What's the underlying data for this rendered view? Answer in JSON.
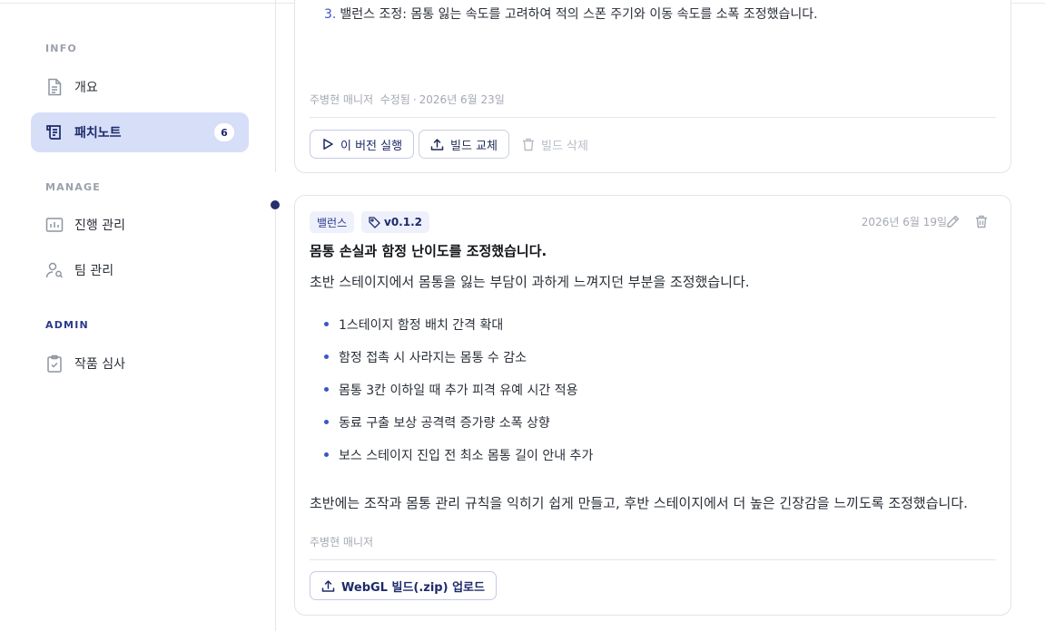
{
  "sidebar": {
    "sections": {
      "info": "INFO",
      "manage": "MANAGE",
      "admin": "ADMIN"
    },
    "items": [
      {
        "label": "개요",
        "icon": "document-icon"
      },
      {
        "label": "패치노트",
        "icon": "patch-notes-icon",
        "badge": "6",
        "active": true
      },
      {
        "label": "진행 관리",
        "icon": "progress-chart-icon"
      },
      {
        "label": "팀 관리",
        "icon": "team-user-icon"
      },
      {
        "label": "작품 심사",
        "icon": "clipboard-check-icon"
      }
    ]
  },
  "previous_note": {
    "list_number": "3.",
    "list_text": "밸런스 조정: 몸통 잃는 속도를 고려하여 적의 스폰 주기와 이동 속도를 소폭 조정했습니다.",
    "author": "주병현 매니저",
    "edited_label": "수정됨",
    "separator": "·",
    "edited_date": "2026년 6월 23일",
    "buttons": {
      "run": "이 버전 실행",
      "replace": "빌드 교체",
      "delete": "빌드 삭제"
    }
  },
  "note": {
    "category_tag": "밸런스",
    "version_tag": "v0.1.2",
    "date": "2026년 6월 19일",
    "title": "몸통 손실과 함정 난이도를 조정했습니다.",
    "intro": "초반 스테이지에서 몸통을 잃는 부담이 과하게 느껴지던 부분을 조정했습니다.",
    "bullets": [
      "1스테이지 함정 배치 간격 확대",
      "함정 접촉 시 사라지는 몸통 수 감소",
      "몸통 3칸 이하일 때 추가 피격 유예 시간 적용",
      "동료 구출 보상 공격력 증가량 소폭 상향",
      "보스 스테이지 진입 전 최소 몸통 길이 안내 추가"
    ],
    "outro": "초반에는 조작과 몸통 관리 규칙을 익히기 쉽게 만들고, 후반 스테이지에서 더 높은 긴장감을 느끼도록 조정했습니다.",
    "author": "주병현 매니저",
    "upload_button": "WebGL 빌드(.zip) 업로드"
  },
  "colors": {
    "accent": "#3b55c9",
    "active_bg": "#d6def8",
    "navy": "#1e2a6b"
  }
}
